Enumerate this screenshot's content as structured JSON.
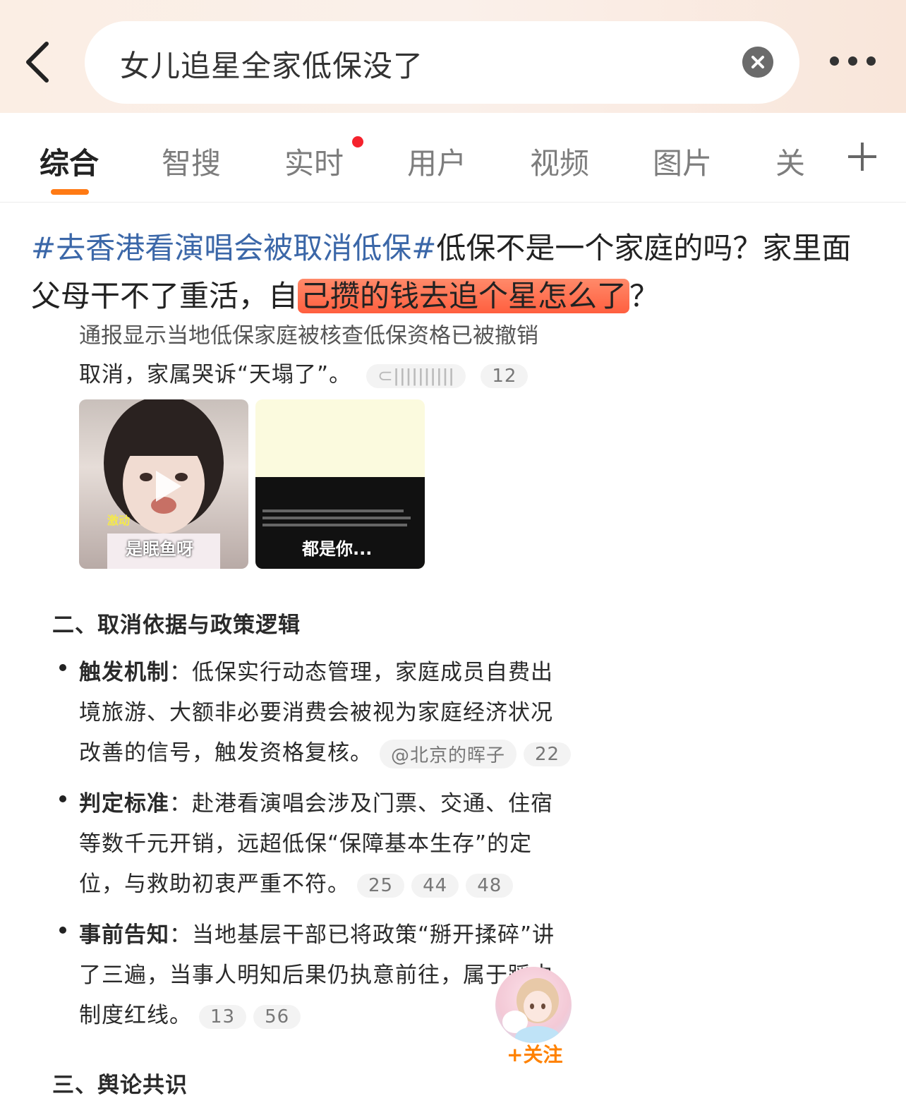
{
  "search": {
    "query": "女儿追星全家低保没了"
  },
  "tabs": [
    {
      "label": "综合"
    },
    {
      "label": "智搜"
    },
    {
      "label": "实时"
    },
    {
      "label": "用户"
    },
    {
      "label": "视频"
    },
    {
      "label": "图片"
    },
    {
      "label": "关"
    }
  ],
  "post": {
    "topic": "#去香港看演唱会被取消低保#",
    "text1": "低保不是一个家庭的吗？家里面父母干不了重活，自",
    "highlight": "己攒的钱去追个星怎么了",
    "text2": "？"
  },
  "screenshot": {
    "line0": "取消，家属哭诉“天塌了”。",
    "line0_chip": "12",
    "thumb1_caption": "是眠鱼呀",
    "thumb1_tag": "激动",
    "thumb2_caption": "都是你...",
    "section2_title": "二、取消依据与政策逻辑",
    "b1_title": "触发机制",
    "b1_l1": "：低保实行动态管理，家庭成员自费出",
    "b1_l2": "境旅游、大额非必要消费会被视为家庭经济状况",
    "b1_l3": "改善的信号，触发资格复核。",
    "b1_chip1": "@北京的晖子",
    "b1_chip2": "22",
    "b2_title": "判定标准",
    "b2_l1": "：赴港看演唱会涉及门票、交通、住宿",
    "b2_l2": "等数千元开销，远超低保“保障基本生存”的定",
    "b2_l3": "位，与救助初衷严重不符。",
    "b2_chip1": "25",
    "b2_chip2": "44",
    "b2_chip3": "48",
    "b3_title": "事前告知",
    "b3_l1": "：当地基层干部已将政策“掰开揉碎”讲",
    "b3_l2": "了三遍，当事人明知后果仍执意前往，属于踩中",
    "b3_l3": "制度红线。",
    "b3_chip1": "13",
    "b3_chip2": "56",
    "section3_title": "三、舆论共识"
  },
  "follow": {
    "label": "+关注"
  },
  "colors": {
    "accent": "#ff7a14",
    "topic": "#3b67a8",
    "highlight": "#ff6a4a",
    "follow": "#ff8200"
  }
}
